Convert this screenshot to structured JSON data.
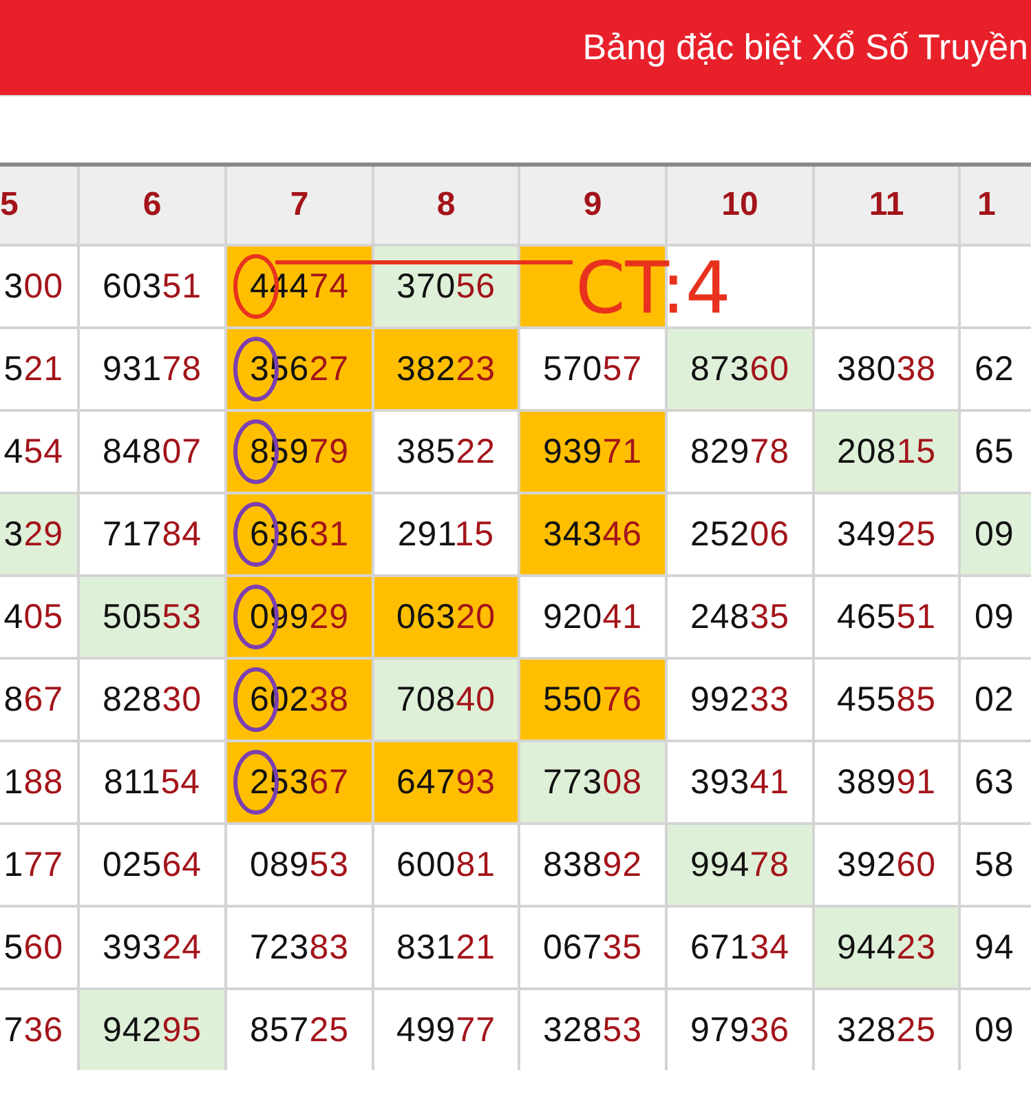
{
  "header": {
    "title": "Bảng đặc biệt Xổ Số Truyền"
  },
  "table": {
    "columns": [
      {
        "label": "5"
      },
      {
        "label": "6"
      },
      {
        "label": "7"
      },
      {
        "label": "8"
      },
      {
        "label": "9"
      },
      {
        "label": "10"
      },
      {
        "label": "11"
      },
      {
        "label": "1"
      }
    ],
    "rows": [
      {
        "cells": [
          {
            "text": "300"
          },
          {
            "text": "60351"
          },
          {
            "text": "44474",
            "color": "#ffbf00",
            "circle": {
              "color": "#e8321e"
            }
          },
          {
            "text": "37056",
            "color": "#dff0d8"
          },
          {
            "color": "#ffbf00"
          },
          {},
          {},
          {}
        ]
      },
      {
        "cells": [
          {
            "text": "521"
          },
          {
            "text": "93178"
          },
          {
            "text": "35627",
            "color": "#ffbf00",
            "circle": {
              "color": "#7b3fb0"
            }
          },
          {
            "text": "38223",
            "color": "#ffbf00"
          },
          {
            "text": "57057"
          },
          {
            "text": "87360",
            "color": "#dff0d8"
          },
          {
            "text": "38038"
          },
          {
            "text": "62"
          }
        ]
      },
      {
        "cells": [
          {
            "text": "454"
          },
          {
            "text": "84807"
          },
          {
            "text": "85979",
            "color": "#ffbf00",
            "circle": {
              "color": "#7b3fb0"
            }
          },
          {
            "text": "38522"
          },
          {
            "text": "93971",
            "color": "#ffbf00"
          },
          {
            "text": "82978"
          },
          {
            "text": "20815",
            "color": "#dff0d8"
          },
          {
            "text": "65"
          }
        ]
      },
      {
        "cells": [
          {
            "text": "329",
            "color": "#dff0d8"
          },
          {
            "text": "71784"
          },
          {
            "text": "63631",
            "color": "#ffbf00",
            "circle": {
              "color": "#7b3fb0"
            }
          },
          {
            "text": "29115"
          },
          {
            "text": "34346",
            "color": "#ffbf00"
          },
          {
            "text": "25206"
          },
          {
            "text": "34925"
          },
          {
            "text": "09",
            "color": "#dff0d8"
          }
        ]
      },
      {
        "cells": [
          {
            "text": "405"
          },
          {
            "text": "50553",
            "color": "#dff0d8"
          },
          {
            "text": "09929",
            "color": "#ffbf00",
            "circle": {
              "color": "#7b3fb0"
            }
          },
          {
            "text": "06320",
            "color": "#ffbf00"
          },
          {
            "text": "92041"
          },
          {
            "text": "24835"
          },
          {
            "text": "46551"
          },
          {
            "text": "09"
          }
        ]
      },
      {
        "cells": [
          {
            "text": "867"
          },
          {
            "text": "82830"
          },
          {
            "text": "60238",
            "color": "#ffbf00",
            "circle": {
              "color": "#7b3fb0"
            }
          },
          {
            "text": "70840",
            "color": "#dff0d8"
          },
          {
            "text": "55076",
            "color": "#ffbf00"
          },
          {
            "text": "99233"
          },
          {
            "text": "45585"
          },
          {
            "text": "02"
          }
        ]
      },
      {
        "cells": [
          {
            "text": "188"
          },
          {
            "text": "81154"
          },
          {
            "text": "25367",
            "color": "#ffbf00",
            "circle": {
              "color": "#7b3fb0"
            }
          },
          {
            "text": "64793",
            "color": "#ffbf00"
          },
          {
            "text": "77308",
            "color": "#dff0d8"
          },
          {
            "text": "39341"
          },
          {
            "text": "38991"
          },
          {
            "text": "63"
          }
        ]
      },
      {
        "cells": [
          {
            "text": "177"
          },
          {
            "text": "02564"
          },
          {
            "text": "08953"
          },
          {
            "text": "60081"
          },
          {
            "text": "83892"
          },
          {
            "text": "99478",
            "color": "#dff0d8"
          },
          {
            "text": "39260"
          },
          {
            "text": "58"
          }
        ]
      },
      {
        "cells": [
          {
            "text": "560"
          },
          {
            "text": "39324"
          },
          {
            "text": "72383"
          },
          {
            "text": "83121"
          },
          {
            "text": "06735"
          },
          {
            "text": "67134"
          },
          {
            "text": "94423",
            "color": "#dff0d8"
          },
          {
            "text": "94"
          }
        ]
      },
      {
        "cells": [
          {
            "text": "736"
          },
          {
            "text": "94295",
            "color": "#dff0d8"
          },
          {
            "text": "85725"
          },
          {
            "text": "49977"
          },
          {
            "text": "32853"
          },
          {
            "text": "97936"
          },
          {
            "text": "32825"
          },
          {
            "text": "09"
          }
        ]
      }
    ]
  },
  "annotation": {
    "text": "CT:4",
    "color": "#e8321e"
  }
}
